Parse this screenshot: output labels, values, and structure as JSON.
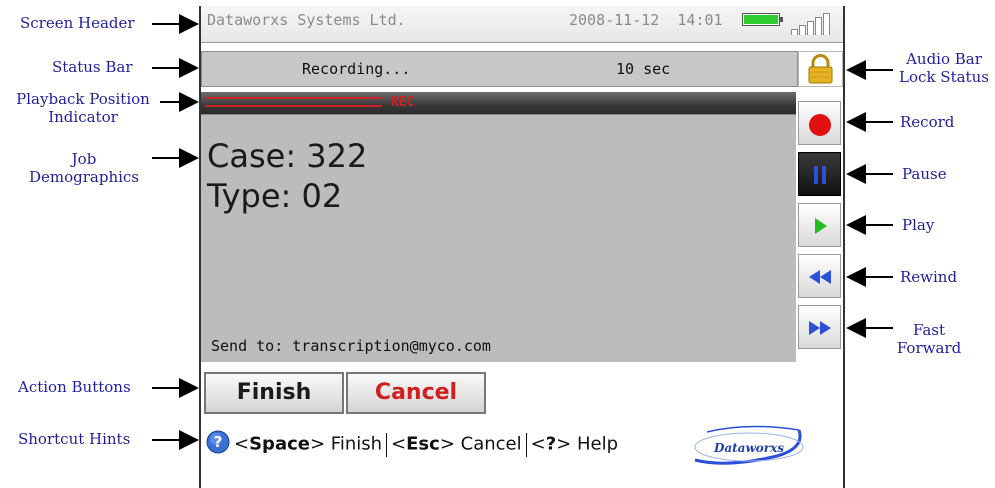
{
  "annotations": {
    "screen_header": "Screen Header",
    "status_bar": "Status Bar",
    "playback_line1": "Playback Position",
    "playback_line2": "Indicator",
    "job_line1": "Job",
    "job_line2": "Demographics",
    "action_buttons": "Action Buttons",
    "shortcut_hints": "Shortcut Hints",
    "audio_line1": "Audio Bar",
    "audio_line2": "Lock Status",
    "record": "Record",
    "pause": "Pause",
    "play": "Play",
    "rewind": "Rewind",
    "ff_line1": "Fast",
    "ff_line2": "Forward"
  },
  "header": {
    "company": "Dataworxs Systems Ltd.",
    "date": "2008-11-12",
    "time": "14:01",
    "battery_level": 1.0,
    "signal_bars": 5
  },
  "status": {
    "state": "Recording...",
    "duration": "10 sec",
    "lock_icon": "padlock-icon"
  },
  "playback": {
    "label": "REC",
    "position": 0.3
  },
  "job": {
    "case_line": "Case: 322",
    "type_line": "Type: 02",
    "send_to": "Send to: transcription@myco.com"
  },
  "transport": {
    "record_icon": "record-icon",
    "pause_icon": "pause-icon",
    "play_icon": "play-icon",
    "rewind_icon": "rewind-icon",
    "fast_forward_icon": "fast-forward-icon"
  },
  "actions": {
    "finish": "Finish",
    "cancel": "Cancel"
  },
  "hints": {
    "space_key": "Space",
    "space_action": "Finish",
    "esc_key": "Esc",
    "esc_action": "Cancel",
    "help_key": "?",
    "help_action": "Help"
  },
  "logo": {
    "text": "Dataworxs"
  },
  "colors": {
    "record": "#e01010",
    "play": "#22bb22",
    "pause": "#2a4fd9",
    "battery": "#2fcf2f",
    "annotation": "#1f1f9c"
  }
}
